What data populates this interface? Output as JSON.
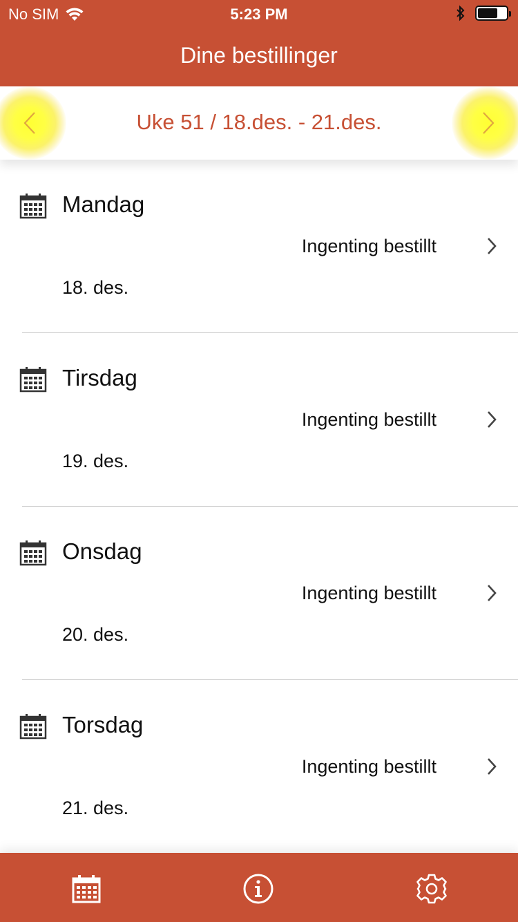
{
  "status_bar": {
    "carrier": "No SIM",
    "time": "5:23 PM",
    "wifi_icon": "wifi-icon",
    "bluetooth_icon": "bluetooth-icon",
    "battery_level": 0.7
  },
  "nav": {
    "title": "Dine bestillinger"
  },
  "week": {
    "label": "Uke 51 / 18.des. - 21.des.",
    "prev_icon": "chevron-left-icon",
    "next_icon": "chevron-right-icon"
  },
  "days": [
    {
      "name": "Mandag",
      "status": "Ingenting bestillt",
      "date": "18. des."
    },
    {
      "name": "Tirsdag",
      "status": "Ingenting bestillt",
      "date": "19. des."
    },
    {
      "name": "Onsdag",
      "status": "Ingenting bestillt",
      "date": "20. des."
    },
    {
      "name": "Torsdag",
      "status": "Ingenting bestillt",
      "date": "21. des."
    }
  ],
  "tabs": [
    {
      "icon": "calendar-icon"
    },
    {
      "icon": "info-icon"
    },
    {
      "icon": "settings-icon"
    }
  ],
  "colors": {
    "brand": "#c75034",
    "highlight": "#ffff44",
    "text": "#111111"
  }
}
